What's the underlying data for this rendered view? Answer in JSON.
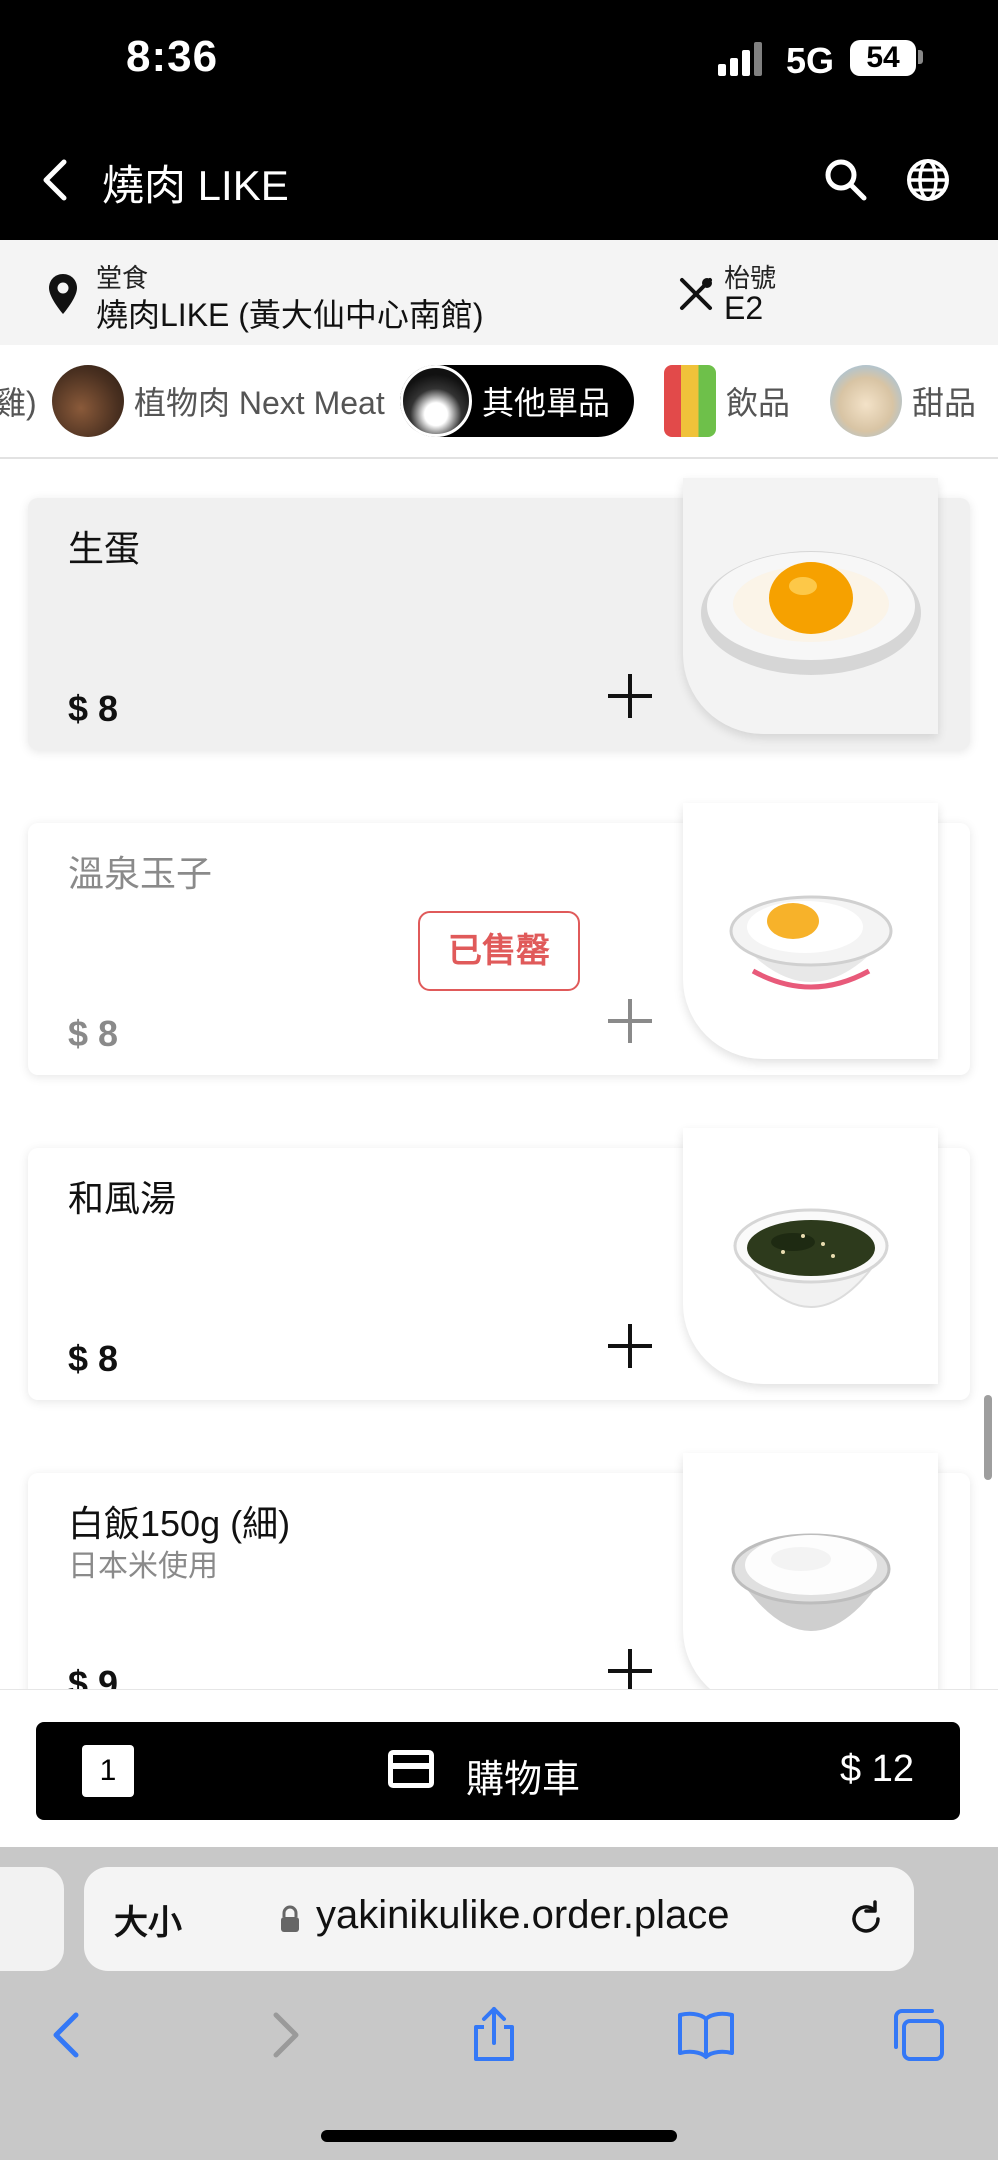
{
  "status_bar": {
    "time": "8:36",
    "network": "5G",
    "battery": "54"
  },
  "header": {
    "title": "燒肉 LIKE"
  },
  "store_info": {
    "mode_label": "堂食",
    "store_name": "燒肉LIKE (黃大仙中心南館)",
    "table_label": "枱號",
    "table_number": "E2"
  },
  "categories": [
    {
      "label": "雞)",
      "active": false
    },
    {
      "label": "植物肉 Next Meat",
      "active": false,
      "thumb_text": "NEXT MEATS"
    },
    {
      "label": "其他單品",
      "active": true,
      "thumb_text": "其他單品"
    },
    {
      "label": "飲品",
      "active": false,
      "thumb_text": "飲品"
    },
    {
      "label": "甜品",
      "active": false,
      "thumb_text": "甜品"
    }
  ],
  "menu_items": [
    {
      "name": "生蛋",
      "subtitle": "",
      "price": "$ 8",
      "sold_out": false,
      "image": "raw-egg"
    },
    {
      "name": "溫泉玉子",
      "subtitle": "",
      "price": "$ 8",
      "sold_out": true,
      "badge": "已售罄",
      "image": "onsen-egg"
    },
    {
      "name": "和風湯",
      "subtitle": "",
      "price": "$ 8",
      "sold_out": false,
      "image": "wakame-soup"
    },
    {
      "name": "白飯150g (細)",
      "subtitle": "日本米使用",
      "price": "$ 9",
      "sold_out": false,
      "image": "rice-bowl"
    }
  ],
  "cart": {
    "count": "1",
    "label": "購物車",
    "total": "$ 12"
  },
  "browser": {
    "text_size": "大小",
    "url": "yakinikulike.order.place"
  },
  "colors": {
    "header_bg": "#000000",
    "sold_out": "#e05a5a",
    "browser_blue": "#3478f6"
  }
}
